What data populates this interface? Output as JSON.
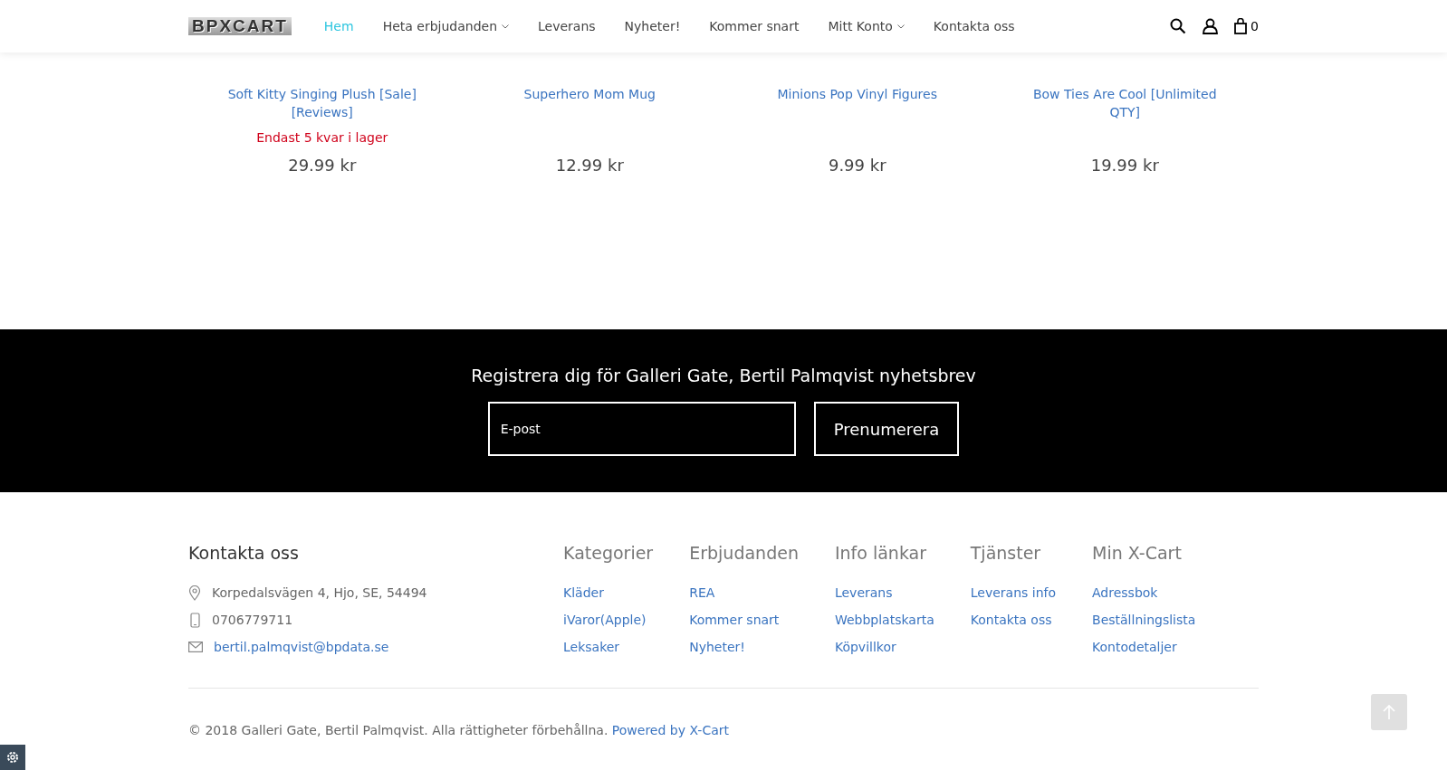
{
  "header": {
    "logo": "BPXCART",
    "nav": [
      {
        "label": "Hem",
        "selected": true,
        "dropdown": false
      },
      {
        "label": "Heta erbjudanden",
        "selected": false,
        "dropdown": true
      },
      {
        "label": "Leverans",
        "selected": false,
        "dropdown": false
      },
      {
        "label": "Nyheter!",
        "selected": false,
        "dropdown": false
      },
      {
        "label": "Kommer snart",
        "selected": false,
        "dropdown": false
      },
      {
        "label": "Mitt Konto",
        "selected": false,
        "dropdown": true
      },
      {
        "label": "Kontakta oss",
        "selected": false,
        "dropdown": false
      }
    ],
    "cart_count": "0"
  },
  "products": [
    {
      "name": "Soft Kitty Singing Plush [Sale] [Reviews]",
      "stock": "Endast 5 kvar i lager",
      "price": "29.99 kr"
    },
    {
      "name": "Superhero Mom Mug",
      "price": "12.99 kr"
    },
    {
      "name": "Minions Pop Vinyl Figures",
      "price": "9.99 kr"
    },
    {
      "name": "Bow Ties Are Cool [Unlimited QTY]",
      "price": "19.99 kr"
    }
  ],
  "newsletter": {
    "title": "Registrera dig för Galleri Gate, Bertil Palmqvist nyhetsbrev",
    "placeholder": "E-post",
    "button": "Prenumerera"
  },
  "footer": {
    "contact": {
      "title": "Kontakta oss",
      "items": [
        {
          "kind": "address",
          "text": "Korpedalsvägen 4, Hjo, SE, 54494"
        },
        {
          "kind": "phone",
          "text": "0706779711"
        },
        {
          "kind": "email",
          "text": "bertil.palmqvist@bpdata.se"
        }
      ]
    },
    "columns": [
      {
        "title": "Kategorier",
        "links": [
          "Kläder",
          "iVaror(Apple)",
          "Leksaker"
        ]
      },
      {
        "title": "Erbjudanden",
        "links": [
          "REA",
          "Kommer snart",
          "Nyheter!"
        ]
      },
      {
        "title": "Info länkar",
        "links": [
          "Leverans",
          "Webbplatskarta",
          "Köpvillkor"
        ]
      },
      {
        "title": "Tjänster",
        "links": [
          "Leverans info",
          "Kontakta oss"
        ]
      },
      {
        "title": "Min X-Cart",
        "links": [
          "Adressbok",
          "Beställningslista",
          "Kontodetaljer"
        ]
      }
    ],
    "copyright": "© 2018 Galleri Gate, Bertil Palmqvist. Alla rättigheter förbehållna.",
    "powered": "Powered by X-Cart"
  }
}
